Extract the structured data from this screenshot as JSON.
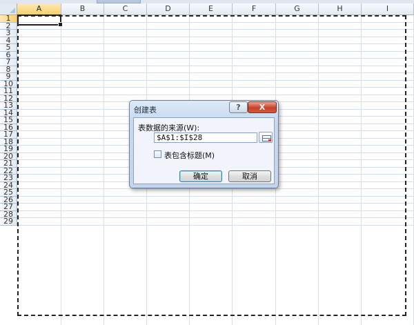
{
  "sheet": {
    "columns": [
      "A",
      "B",
      "C",
      "D",
      "E",
      "F",
      "G",
      "H",
      "I"
    ],
    "rows": [
      "1",
      "2",
      "3",
      "4",
      "5",
      "6",
      "7",
      "8",
      "9",
      "10",
      "11",
      "12",
      "13",
      "14",
      "15",
      "16",
      "17",
      "18",
      "19",
      "20",
      "21",
      "22",
      "23",
      "24",
      "25",
      "26",
      "27",
      "28",
      "29"
    ],
    "selected_column": "A",
    "selected_row": "1"
  },
  "dialog": {
    "title": "创建表",
    "help_label": "?",
    "close_label": "X",
    "source_label": "表数据的来源(W):",
    "range_value": "$A$1:$I$28",
    "header_checkbox_label": "表包含标题(M)",
    "header_checkbox_checked": false,
    "ok_label": "确定",
    "cancel_label": "取消"
  },
  "colors": {
    "header_selected": "#f7cf6f",
    "grid_line": "#d5dfea",
    "dialog_bg": "#c2d5ee",
    "close_button": "#c5432a"
  }
}
